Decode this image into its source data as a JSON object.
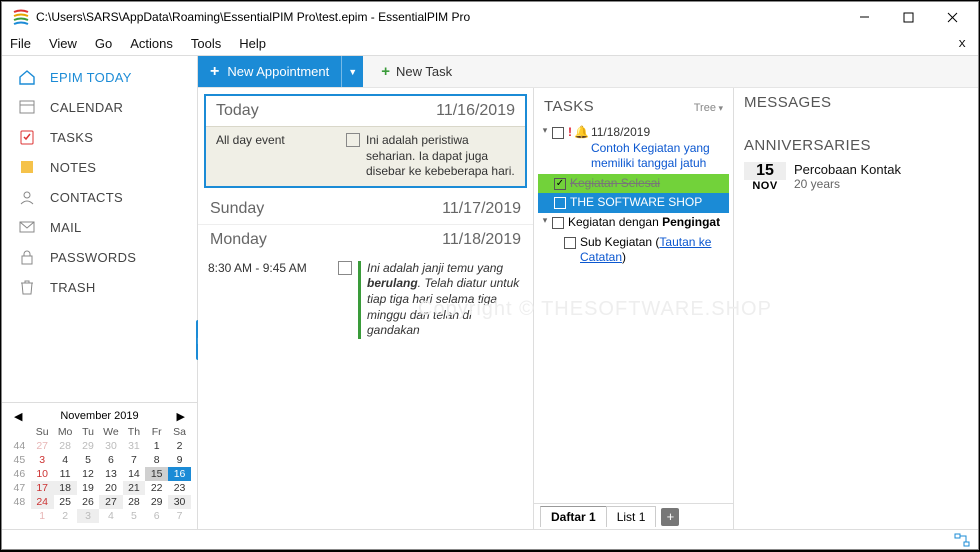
{
  "window": {
    "title": "C:\\Users\\SARS\\AppData\\Roaming\\EssentialPIM Pro\\test.epim - EssentialPIM Pro"
  },
  "menu": [
    "File",
    "View",
    "Go",
    "Actions",
    "Tools",
    "Help"
  ],
  "sidebar": {
    "items": [
      {
        "label": "EPIM TODAY"
      },
      {
        "label": "CALENDAR"
      },
      {
        "label": "TASKS"
      },
      {
        "label": "NOTES"
      },
      {
        "label": "CONTACTS"
      },
      {
        "label": "MAIL"
      },
      {
        "label": "PASSWORDS"
      },
      {
        "label": "TRASH"
      }
    ]
  },
  "minical": {
    "title": "November  2019"
  },
  "toolbar": {
    "new_appointment": "New Appointment",
    "new_task": "New Task"
  },
  "agenda": {
    "days": [
      {
        "title": "Today",
        "date": "11/16/2019",
        "events": [
          {
            "time": "All day event",
            "desc": "Ini adalah peristiwa seharian. Ia dapat juga disebar ke kebeberapa hari."
          }
        ]
      },
      {
        "title": "Sunday",
        "date": "11/17/2019",
        "events": []
      },
      {
        "title": "Monday",
        "date": "11/18/2019",
        "events": [
          {
            "time": "8:30 AM - 9:45 AM",
            "desc_pre": "Ini adalah janji temu yang ",
            "desc_b": "berulang",
            "desc_post": ". Telah diatur untuk tiap tiga hari selama tiga minggu dan telah di gandakan"
          }
        ]
      }
    ]
  },
  "tasks": {
    "header": "TASKS",
    "tree_label": "Tree",
    "t0_date": "11/18/2019",
    "t0_link": "Contoh Kegiatan yang memiliki tanggal jatuh",
    "t1": "Kegiatan Selesai",
    "t2": "THE SOFTWARE SHOP",
    "t3_a": "Kegiatan dengan ",
    "t3_b": "Pengingat",
    "t4_a": "Sub Kegiatan (",
    "t4_link": "Tautan ke Catatan",
    "t4_b": ")",
    "tab1": "Daftar 1",
    "tab2": "List 1"
  },
  "messages": {
    "header": "MESSAGES"
  },
  "anniv": {
    "header": "ANNIVERSARIES",
    "day": "15",
    "mon": "NOV",
    "name": "Percobaan Kontak",
    "age": "20 years"
  },
  "watermark": "Copyright © THESOFTWARE.SHOP"
}
